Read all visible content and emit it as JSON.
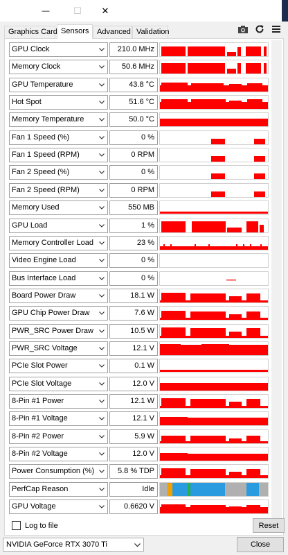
{
  "window": {
    "minimize_glyph": "—",
    "maximize_glyph": "☐",
    "close_glyph": "✕"
  },
  "tabs": [
    {
      "label": "Graphics Card",
      "active": false
    },
    {
      "label": "Sensors",
      "active": true
    },
    {
      "label": "Advanced",
      "active": false
    },
    {
      "label": "Validation",
      "active": false
    }
  ],
  "toolbar": {
    "icons": [
      "camera-icon",
      "refresh-icon",
      "menu-icon"
    ]
  },
  "colors": {
    "graph": "#ff0000",
    "perfcap_idle": "#b0b0b0",
    "perfcap_util": "#2b9be0",
    "perfcap_vrel": "#f0a000",
    "perfcap_pwr": "#29b04a",
    "title_dark": "#1c2c4e"
  },
  "sensors": [
    {
      "name": "GPU Clock",
      "value": "210.0 MHz"
    },
    {
      "name": "Memory Clock",
      "value": "50.6 MHz"
    },
    {
      "name": "GPU Temperature",
      "value": "43.8 °C"
    },
    {
      "name": "Hot Spot",
      "value": "51.6 °C"
    },
    {
      "name": "Memory Temperature",
      "value": "50.0 °C"
    },
    {
      "name": "Fan 1 Speed (%)",
      "value": "0 %"
    },
    {
      "name": "Fan 1 Speed (RPM)",
      "value": "0 RPM"
    },
    {
      "name": "Fan 2 Speed (%)",
      "value": "0 %"
    },
    {
      "name": "Fan 2 Speed (RPM)",
      "value": "0 RPM"
    },
    {
      "name": "Memory Used",
      "value": "550 MB"
    },
    {
      "name": "GPU Load",
      "value": "1 %"
    },
    {
      "name": "Memory Controller Load",
      "value": "23 %"
    },
    {
      "name": "Video Engine Load",
      "value": "0 %"
    },
    {
      "name": "Bus Interface Load",
      "value": "0 %"
    },
    {
      "name": "Board Power Draw",
      "value": "18.1 W"
    },
    {
      "name": "GPU Chip Power Draw",
      "value": "7.6 W"
    },
    {
      "name": "PWR_SRC Power Draw",
      "value": "10.5 W"
    },
    {
      "name": "PWR_SRC Voltage",
      "value": "12.1 V"
    },
    {
      "name": "PCIe Slot Power",
      "value": "0.1 W"
    },
    {
      "name": "PCIe Slot Voltage",
      "value": "12.0 V"
    },
    {
      "name": "8-Pin #1 Power",
      "value": "12.1 W"
    },
    {
      "name": "8-Pin #1 Voltage",
      "value": "12.1 V"
    },
    {
      "name": "8-Pin #2 Power",
      "value": "5.9 W"
    },
    {
      "name": "8-Pin #2 Voltage",
      "value": "12.0 V"
    },
    {
      "name": "Power Consumption (%)",
      "value": "5.8 % TDP"
    },
    {
      "name": "PerfCap Reason",
      "value": "Idle"
    },
    {
      "name": "GPU Voltage",
      "value": "0.6620 V"
    }
  ],
  "footer": {
    "log_label": "Log to file",
    "log_checked": false,
    "reset_label": "Reset",
    "gpu_name": "NVIDIA GeForce RTX 3070 Ti",
    "close_label": "Close"
  }
}
